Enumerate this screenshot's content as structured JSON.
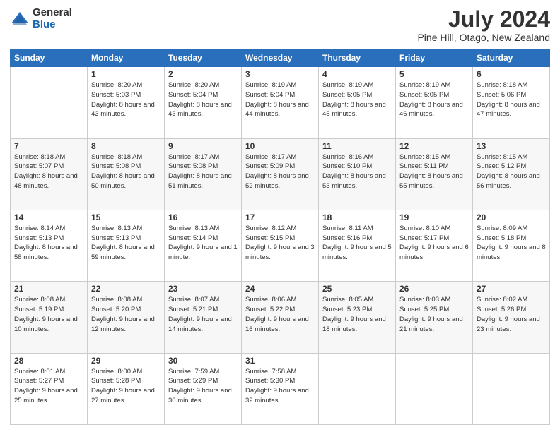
{
  "logo": {
    "general": "General",
    "blue": "Blue"
  },
  "title": "July 2024",
  "subtitle": "Pine Hill, Otago, New Zealand",
  "headers": [
    "Sunday",
    "Monday",
    "Tuesday",
    "Wednesday",
    "Thursday",
    "Friday",
    "Saturday"
  ],
  "weeks": [
    [
      {
        "day": "",
        "sunrise": "",
        "sunset": "",
        "daylight": ""
      },
      {
        "day": "1",
        "sunrise": "Sunrise: 8:20 AM",
        "sunset": "Sunset: 5:03 PM",
        "daylight": "Daylight: 8 hours and 43 minutes."
      },
      {
        "day": "2",
        "sunrise": "Sunrise: 8:20 AM",
        "sunset": "Sunset: 5:04 PM",
        "daylight": "Daylight: 8 hours and 43 minutes."
      },
      {
        "day": "3",
        "sunrise": "Sunrise: 8:19 AM",
        "sunset": "Sunset: 5:04 PM",
        "daylight": "Daylight: 8 hours and 44 minutes."
      },
      {
        "day": "4",
        "sunrise": "Sunrise: 8:19 AM",
        "sunset": "Sunset: 5:05 PM",
        "daylight": "Daylight: 8 hours and 45 minutes."
      },
      {
        "day": "5",
        "sunrise": "Sunrise: 8:19 AM",
        "sunset": "Sunset: 5:05 PM",
        "daylight": "Daylight: 8 hours and 46 minutes."
      },
      {
        "day": "6",
        "sunrise": "Sunrise: 8:18 AM",
        "sunset": "Sunset: 5:06 PM",
        "daylight": "Daylight: 8 hours and 47 minutes."
      }
    ],
    [
      {
        "day": "7",
        "sunrise": "Sunrise: 8:18 AM",
        "sunset": "Sunset: 5:07 PM",
        "daylight": "Daylight: 8 hours and 48 minutes."
      },
      {
        "day": "8",
        "sunrise": "Sunrise: 8:18 AM",
        "sunset": "Sunset: 5:08 PM",
        "daylight": "Daylight: 8 hours and 50 minutes."
      },
      {
        "day": "9",
        "sunrise": "Sunrise: 8:17 AM",
        "sunset": "Sunset: 5:08 PM",
        "daylight": "Daylight: 8 hours and 51 minutes."
      },
      {
        "day": "10",
        "sunrise": "Sunrise: 8:17 AM",
        "sunset": "Sunset: 5:09 PM",
        "daylight": "Daylight: 8 hours and 52 minutes."
      },
      {
        "day": "11",
        "sunrise": "Sunrise: 8:16 AM",
        "sunset": "Sunset: 5:10 PM",
        "daylight": "Daylight: 8 hours and 53 minutes."
      },
      {
        "day": "12",
        "sunrise": "Sunrise: 8:15 AM",
        "sunset": "Sunset: 5:11 PM",
        "daylight": "Daylight: 8 hours and 55 minutes."
      },
      {
        "day": "13",
        "sunrise": "Sunrise: 8:15 AM",
        "sunset": "Sunset: 5:12 PM",
        "daylight": "Daylight: 8 hours and 56 minutes."
      }
    ],
    [
      {
        "day": "14",
        "sunrise": "Sunrise: 8:14 AM",
        "sunset": "Sunset: 5:13 PM",
        "daylight": "Daylight: 8 hours and 58 minutes."
      },
      {
        "day": "15",
        "sunrise": "Sunrise: 8:13 AM",
        "sunset": "Sunset: 5:13 PM",
        "daylight": "Daylight: 8 hours and 59 minutes."
      },
      {
        "day": "16",
        "sunrise": "Sunrise: 8:13 AM",
        "sunset": "Sunset: 5:14 PM",
        "daylight": "Daylight: 9 hours and 1 minute."
      },
      {
        "day": "17",
        "sunrise": "Sunrise: 8:12 AM",
        "sunset": "Sunset: 5:15 PM",
        "daylight": "Daylight: 9 hours and 3 minutes."
      },
      {
        "day": "18",
        "sunrise": "Sunrise: 8:11 AM",
        "sunset": "Sunset: 5:16 PM",
        "daylight": "Daylight: 9 hours and 5 minutes."
      },
      {
        "day": "19",
        "sunrise": "Sunrise: 8:10 AM",
        "sunset": "Sunset: 5:17 PM",
        "daylight": "Daylight: 9 hours and 6 minutes."
      },
      {
        "day": "20",
        "sunrise": "Sunrise: 8:09 AM",
        "sunset": "Sunset: 5:18 PM",
        "daylight": "Daylight: 9 hours and 8 minutes."
      }
    ],
    [
      {
        "day": "21",
        "sunrise": "Sunrise: 8:08 AM",
        "sunset": "Sunset: 5:19 PM",
        "daylight": "Daylight: 9 hours and 10 minutes."
      },
      {
        "day": "22",
        "sunrise": "Sunrise: 8:08 AM",
        "sunset": "Sunset: 5:20 PM",
        "daylight": "Daylight: 9 hours and 12 minutes."
      },
      {
        "day": "23",
        "sunrise": "Sunrise: 8:07 AM",
        "sunset": "Sunset: 5:21 PM",
        "daylight": "Daylight: 9 hours and 14 minutes."
      },
      {
        "day": "24",
        "sunrise": "Sunrise: 8:06 AM",
        "sunset": "Sunset: 5:22 PM",
        "daylight": "Daylight: 9 hours and 16 minutes."
      },
      {
        "day": "25",
        "sunrise": "Sunrise: 8:05 AM",
        "sunset": "Sunset: 5:23 PM",
        "daylight": "Daylight: 9 hours and 18 minutes."
      },
      {
        "day": "26",
        "sunrise": "Sunrise: 8:03 AM",
        "sunset": "Sunset: 5:25 PM",
        "daylight": "Daylight: 9 hours and 21 minutes."
      },
      {
        "day": "27",
        "sunrise": "Sunrise: 8:02 AM",
        "sunset": "Sunset: 5:26 PM",
        "daylight": "Daylight: 9 hours and 23 minutes."
      }
    ],
    [
      {
        "day": "28",
        "sunrise": "Sunrise: 8:01 AM",
        "sunset": "Sunset: 5:27 PM",
        "daylight": "Daylight: 9 hours and 25 minutes."
      },
      {
        "day": "29",
        "sunrise": "Sunrise: 8:00 AM",
        "sunset": "Sunset: 5:28 PM",
        "daylight": "Daylight: 9 hours and 27 minutes."
      },
      {
        "day": "30",
        "sunrise": "Sunrise: 7:59 AM",
        "sunset": "Sunset: 5:29 PM",
        "daylight": "Daylight: 9 hours and 30 minutes."
      },
      {
        "day": "31",
        "sunrise": "Sunrise: 7:58 AM",
        "sunset": "Sunset: 5:30 PM",
        "daylight": "Daylight: 9 hours and 32 minutes."
      },
      {
        "day": "",
        "sunrise": "",
        "sunset": "",
        "daylight": ""
      },
      {
        "day": "",
        "sunrise": "",
        "sunset": "",
        "daylight": ""
      },
      {
        "day": "",
        "sunrise": "",
        "sunset": "",
        "daylight": ""
      }
    ]
  ]
}
